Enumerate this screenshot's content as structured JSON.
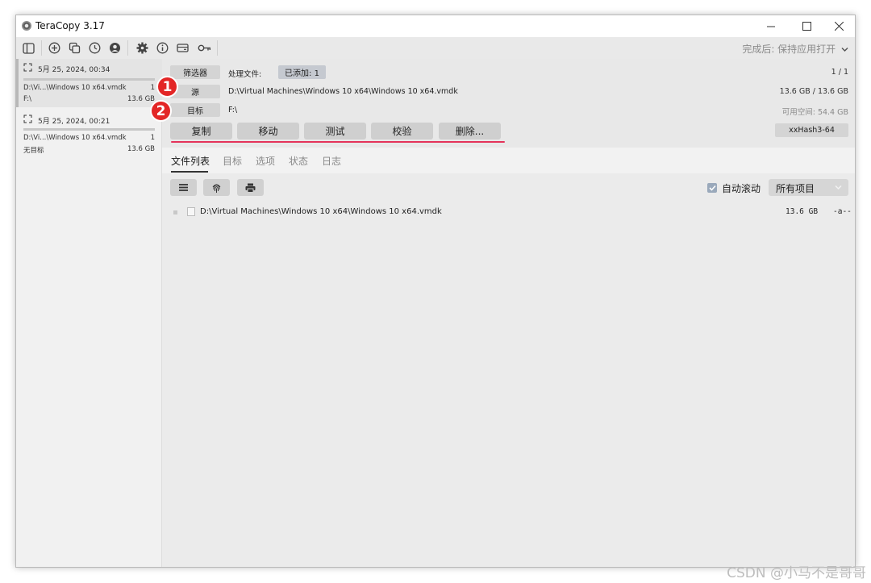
{
  "window": {
    "title": "TeraCopy 3.17"
  },
  "toolbar": {
    "after_done": "完成后: 保持应用打开"
  },
  "sidebar": {
    "jobs": [
      {
        "date": "5月 25, 2024, 00:34",
        "source": "D:\\Vi...\\Windows 10 x64.vmdk",
        "count": "1",
        "target": "F:\\",
        "size": "13.6 GB"
      },
      {
        "date": "5月 25, 2024, 00:21",
        "source": "D:\\Vi...\\Windows 10 x64.vmdk",
        "count": "1",
        "target": "无目标",
        "size": "13.6 GB"
      }
    ]
  },
  "header": {
    "filter_label": "筛选器",
    "processing_label": "处理文件:",
    "added_label": "已添加: 1",
    "page_count": "1 / 1",
    "source_label": "源",
    "source_path": "D:\\Virtual Machines\\Windows 10 x64\\Windows 10 x64.vmdk",
    "source_size": "13.6 GB / 13.6 GB",
    "target_label": "目标",
    "target_path": "F:\\",
    "free_space": "可用空间:  54.4 GB",
    "hash": "xxHash3-64"
  },
  "actions": {
    "copy": "复制",
    "move": "移动",
    "test": "测试",
    "verify": "校验",
    "delete": "删除..."
  },
  "badges": {
    "one": "1",
    "two": "2"
  },
  "tabs": [
    "文件列表",
    "目标",
    "选项",
    "状态",
    "日志"
  ],
  "list": {
    "auto_scroll": "自动滚动",
    "filter_value": "所有项目",
    "files": [
      {
        "path": "D:\\Virtual Machines\\Windows 10 x64\\Windows 10 x64.vmdk",
        "size": "13.6 GB",
        "attr": "-a--"
      }
    ]
  },
  "watermark": "CSDN @小马不是哥哥",
  "colors": {
    "accent_red": "#e4335a",
    "badge_red": "#e32626",
    "checkbox": "#9aa9bb"
  }
}
